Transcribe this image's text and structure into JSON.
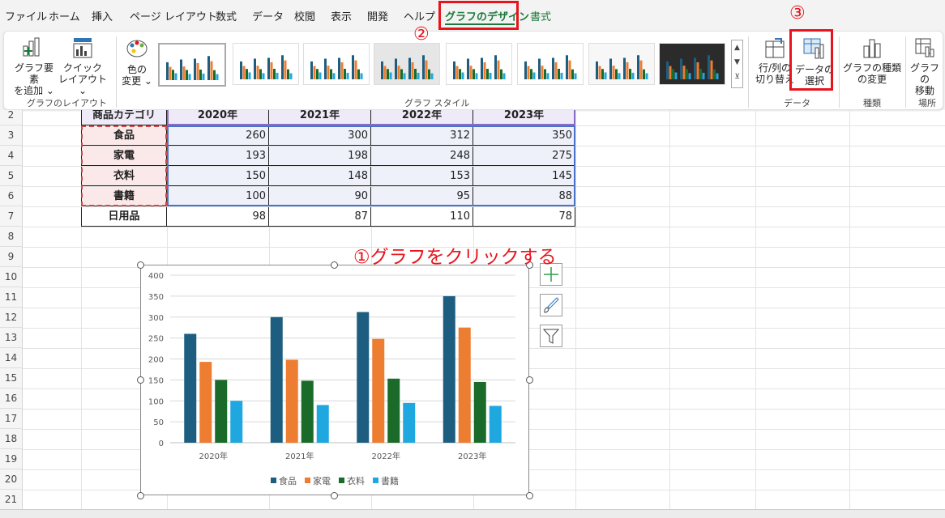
{
  "tabs": [
    "ファイル",
    "ホーム",
    "挿入",
    "ページ レイアウト",
    "数式",
    "データ",
    "校閲",
    "表示",
    "開発",
    "ヘルプ",
    "グラフのデザイン",
    "書式"
  ],
  "active_tab": "グラフのデザイン",
  "ribbon": {
    "add_element": [
      "グラフ要素",
      "を追加 ⌄"
    ],
    "quick_layout": [
      "クイック",
      "レイアウト ⌄"
    ],
    "change_color": [
      "色の",
      "変更 ⌄"
    ],
    "group_layout": "グラフのレイアウト",
    "group_style": "グラフ スタイル",
    "switch_row_col": [
      "行/列の",
      "切り替え"
    ],
    "select_data": [
      "データの",
      "選択"
    ],
    "group_data": "データ",
    "change_type": [
      "グラフの種類",
      "の変更"
    ],
    "group_type": "種類",
    "move_chart": [
      "グラフの",
      "移動"
    ],
    "group_location": "場所"
  },
  "annotations": {
    "step1": "①グラフをクリックする",
    "step2": "②",
    "step3": "③"
  },
  "colors": {
    "s1": "#1d5e80",
    "s2": "#ed7d31",
    "s3": "#1a6b2a",
    "s4": "#1fa7e0",
    "accent": "#e8141d",
    "active_tab": "#1a7a3a"
  },
  "row_numbers": [
    "2",
    "3",
    "4",
    "5",
    "6",
    "7",
    "8",
    "9",
    "10",
    "11",
    "12",
    "13",
    "14",
    "15",
    "16",
    "17",
    "18",
    "19",
    "20",
    "21"
  ],
  "table": {
    "header": [
      "商品カテゴリ",
      "2020年",
      "2021年",
      "2022年",
      "2023年"
    ],
    "rows": [
      [
        "食品",
        "260",
        "300",
        "312",
        "350"
      ],
      [
        "家電",
        "193",
        "198",
        "248",
        "275"
      ],
      [
        "衣料",
        "150",
        "148",
        "153",
        "145"
      ],
      [
        "書籍",
        "100",
        "90",
        "95",
        "88"
      ],
      [
        "日用品",
        "98",
        "87",
        "110",
        "78"
      ]
    ]
  },
  "chart_data": {
    "type": "bar",
    "categories": [
      "2020年",
      "2021年",
      "2022年",
      "2023年"
    ],
    "series": [
      {
        "name": "食品",
        "values": [
          260,
          300,
          312,
          350
        ]
      },
      {
        "name": "家電",
        "values": [
          193,
          198,
          248,
          275
        ]
      },
      {
        "name": "衣料",
        "values": [
          150,
          148,
          153,
          145
        ]
      },
      {
        "name": "書籍",
        "values": [
          100,
          90,
          95,
          88
        ]
      }
    ],
    "yticks": [
      "0",
      "50",
      "100",
      "150",
      "200",
      "250",
      "300",
      "350",
      "400"
    ],
    "ylim": [
      0,
      400
    ],
    "grid": true,
    "legend": "bottom"
  }
}
